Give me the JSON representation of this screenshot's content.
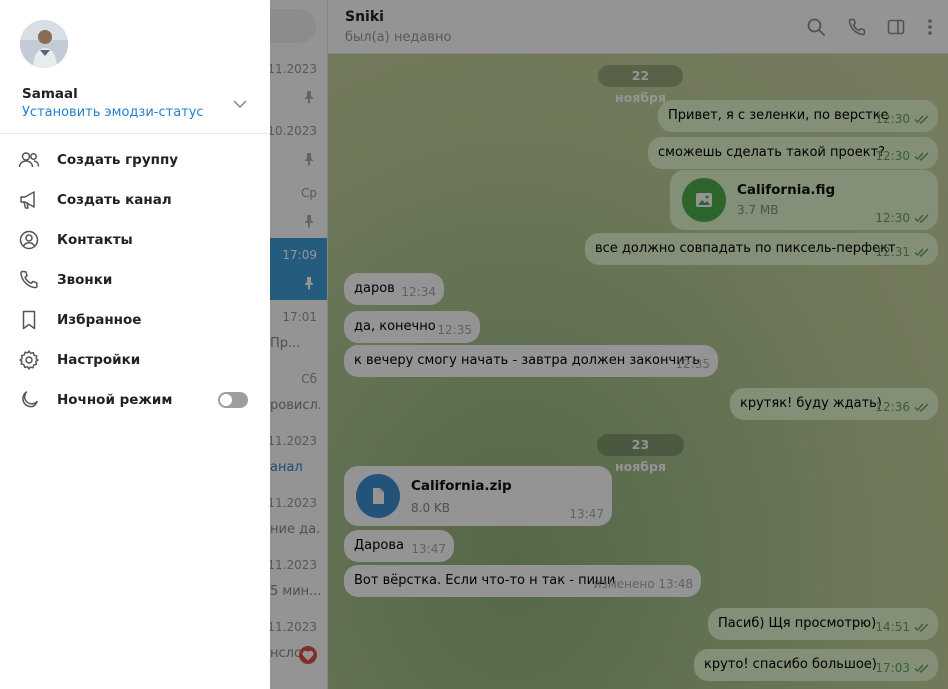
{
  "drawer": {
    "user_name": "Samaal",
    "emoji_status": "Установить эмодзи-статус",
    "menu": [
      {
        "label": "Создать группу",
        "icon": "people-icon"
      },
      {
        "label": "Создать канал",
        "icon": "megaphone-icon"
      },
      {
        "label": "Контакты",
        "icon": "contact-icon"
      },
      {
        "label": "Звонки",
        "icon": "phone-icon"
      },
      {
        "label": "Избранное",
        "icon": "bookmark-icon"
      },
      {
        "label": "Настройки",
        "icon": "gear-icon"
      },
      {
        "label": "Ночной режим",
        "icon": "moon-icon"
      }
    ],
    "night_mode_on": false
  },
  "chat_list": {
    "rows": [
      {
        "date": ".11.2023",
        "preview": ""
      },
      {
        "date": ".10.2023",
        "preview": ""
      },
      {
        "date": "Ср",
        "preview": ""
      },
      {
        "date": "17:09",
        "preview": ""
      },
      {
        "date": "17:01",
        "preview": "Пр..."
      },
      {
        "date": "Сб",
        "preview": "ровисл..."
      },
      {
        "date": ".11.2023",
        "preview": "анал"
      },
      {
        "date": ".11.2023",
        "preview": "ние да..."
      },
      {
        "date": ".11.2023",
        "preview": "5 мин..."
      },
      {
        "date": ".11.2023",
        "preview": "нслс..."
      }
    ]
  },
  "chat": {
    "title": "Sniki",
    "status": "был(а) недавно",
    "header_icons": [
      "search-icon",
      "phone-icon",
      "sidebar-panel-icon",
      "more-vertical-icon"
    ],
    "date_separators": [
      "22 ноября",
      "23 ноября"
    ],
    "messages": [
      {
        "text": "Привет, я с зеленки, по верстке",
        "time": "12:30",
        "dir": "out"
      },
      {
        "text": "сможешь сделать такой проект?",
        "time": "12:30",
        "dir": "out"
      },
      {
        "file_name": "California.fig",
        "file_size": "3.7 MB",
        "time": "12:30",
        "dir": "out"
      },
      {
        "text": "все должно совпадать по пиксель-перфект",
        "time": "12:31",
        "dir": "out"
      },
      {
        "text": "даров",
        "time": "12:34",
        "dir": "in"
      },
      {
        "text": "да, конечно",
        "time": "12:35",
        "dir": "in"
      },
      {
        "text": "к вечеру смогу начать - завтра должен закончить",
        "time": "12:35",
        "dir": "in"
      },
      {
        "text": "крутяк! буду ждать)",
        "time": "12:36",
        "dir": "out"
      },
      {
        "file_name": "California.zip",
        "file_size": "8.0 KB",
        "time": "13:47",
        "dir": "in"
      },
      {
        "text": "Дарова",
        "time": "13:47",
        "dir": "in"
      },
      {
        "text": "Вот вёрстка. Если что-то н так - пиши",
        "time": "изменено 13:48",
        "dir": "in"
      },
      {
        "text": "Пасиб) Щя просмотрю)",
        "time": "14:51",
        "dir": "out"
      },
      {
        "text": "круто! спасибо большое)",
        "time": "17:03",
        "dir": "out"
      }
    ]
  },
  "colors": {
    "accent": "#2481cc",
    "active_chat": "#419fd9",
    "outgoing_bubble": "#e2f6cc",
    "file_green": "#4fae4e",
    "file_blue": "#3f8fd2"
  }
}
